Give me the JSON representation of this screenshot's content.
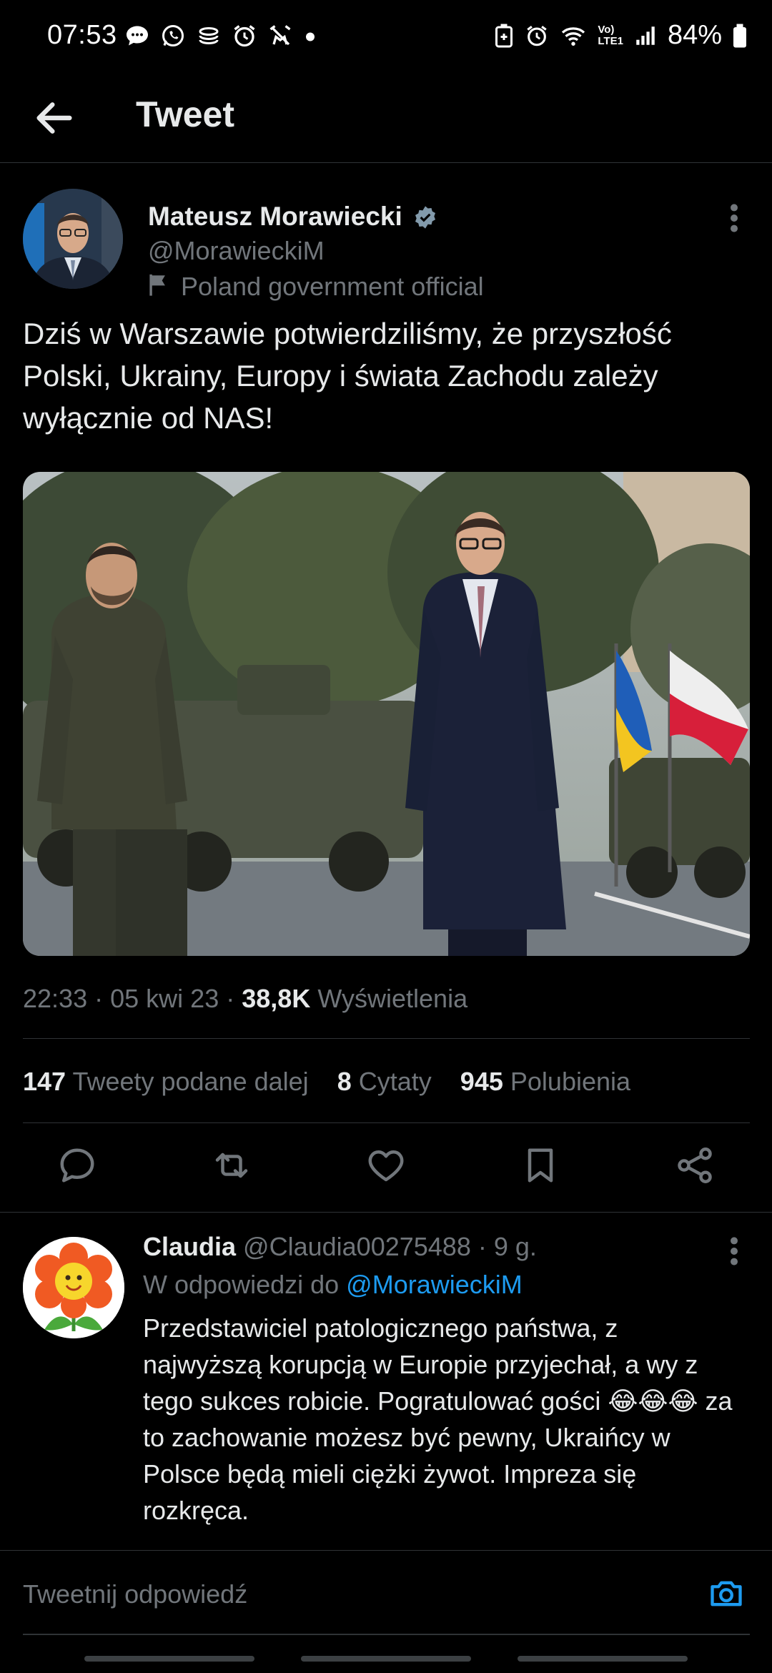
{
  "status_bar": {
    "time": "07:53",
    "left_icons": [
      "chat-bubble-icon",
      "whatsapp-icon",
      "coin-stack-icon",
      "alarm-icon",
      "muted-alarm-icon",
      "dot-icon"
    ],
    "right_icons": [
      "battery-saver-icon",
      "alarm-icon",
      "wifi-icon",
      "volte-icon",
      "signal-icon"
    ],
    "volte_label": "Vo)\nLTE1",
    "battery": "84%"
  },
  "header": {
    "title": "Tweet",
    "back_icon": "arrow-left-icon"
  },
  "tweet": {
    "author_name": "Mateusz Morawiecki",
    "handle": "@MorawieckiM",
    "affiliation": "Poland government official",
    "text": "Dziś w Warszawie potwierdziliśmy, że przyszłość Polski, Ukrainy, Europy i świata Zachodu zależy wyłącznie od NAS!",
    "time": "22:33",
    "date": "05 kwi 23",
    "views": "38,8K",
    "views_label": "Wyświetlenia",
    "sep": "·",
    "retweets_count": "147",
    "retweets_label": "Tweety podane dalej",
    "quotes_count": "8",
    "quotes_label": "Cytaty",
    "likes_count": "945",
    "likes_label": "Polubienia"
  },
  "actions": [
    "reply-icon",
    "retweet-icon",
    "like-icon",
    "bookmark-icon",
    "share-icon"
  ],
  "reply": {
    "name": "Claudia",
    "handle": "@Claudia00275488",
    "time": "· 9 g.",
    "reply_to_label": "W odpowiedzi do",
    "reply_to_handle": "@MorawieckiM",
    "text": "Przedstawiciel patologicznego państwa, z najwyższą korupcją w Europie przyjechał, a wy z tego sukces robicie. Pogratulować gości 😂😂😂 za to zachowanie możesz być pewny, Ukraińcy w Polsce będą mieli ciężki żywot. Impreza się rozkręca."
  },
  "compose": {
    "placeholder": "Tweetnij odpowiedź"
  },
  "colors": {
    "background": "#000000",
    "text_primary": "#e7e9ea",
    "text_secondary": "#71767b",
    "accent": "#1d9bf0",
    "divider": "#2f3336"
  }
}
